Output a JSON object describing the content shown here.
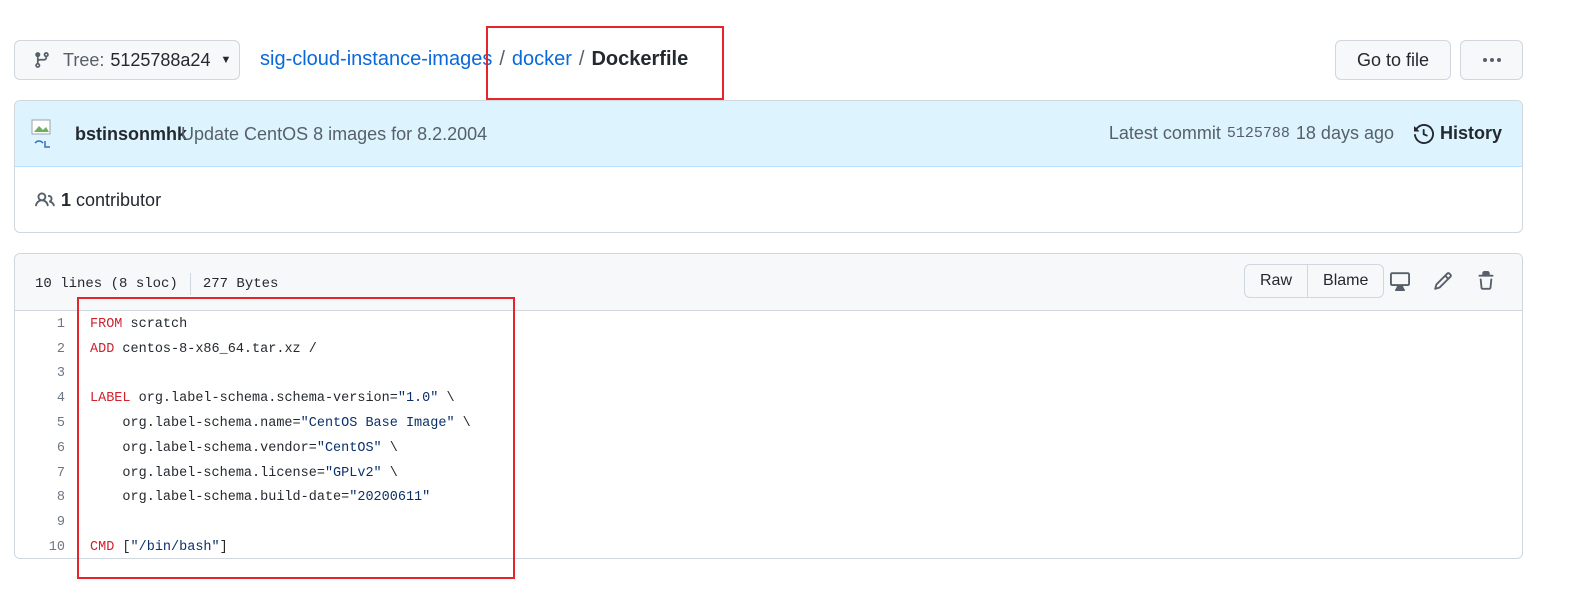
{
  "branch": {
    "label": "Tree:",
    "sha": "5125788a24"
  },
  "breadcrumb": {
    "repo": "sig-cloud-instance-images",
    "folder": "docker",
    "file": "Dockerfile",
    "separator": "/"
  },
  "actions": {
    "go_to_file": "Go to file",
    "more": "more-icon"
  },
  "commit": {
    "author": "bstinsonmhk",
    "message": "Update CentOS 8 images for 8.2.2004",
    "latest_label": "Latest commit",
    "sha": "5125788",
    "time": "18 days ago",
    "history_label": "History"
  },
  "contributors": {
    "count": "1",
    "label": "contributor"
  },
  "file": {
    "lines_info": "10 lines (8 sloc)",
    "size": "277 Bytes",
    "raw_label": "Raw",
    "blame_label": "Blame"
  },
  "code": {
    "line_numbers": [
      "1",
      "2",
      "3",
      "4",
      "5",
      "6",
      "7",
      "8",
      "9",
      "10"
    ],
    "lines": [
      {
        "kw": "FROM",
        "rest": " scratch",
        "str": "",
        "tail": ""
      },
      {
        "kw": "ADD",
        "rest": " centos-8-x86_64.tar.xz /",
        "str": "",
        "tail": ""
      },
      {
        "kw": "",
        "rest": "",
        "str": "",
        "tail": ""
      },
      {
        "kw": "LABEL",
        "rest": " org.label-schema.schema-version=",
        "str": "\"1.0\"",
        "tail": " \\"
      },
      {
        "kw": "",
        "rest": "    org.label-schema.name=",
        "str": "\"CentOS Base Image\"",
        "tail": " \\"
      },
      {
        "kw": "",
        "rest": "    org.label-schema.vendor=",
        "str": "\"CentOS\"",
        "tail": " \\"
      },
      {
        "kw": "",
        "rest": "    org.label-schema.license=",
        "str": "\"GPLv2\"",
        "tail": " \\"
      },
      {
        "kw": "",
        "rest": "    org.label-schema.build-date=",
        "str": "\"20200611\"",
        "tail": ""
      },
      {
        "kw": "",
        "rest": "",
        "str": "",
        "tail": ""
      },
      {
        "kw": "CMD",
        "rest": " [",
        "str": "\"/bin/bash\"",
        "tail": "]"
      }
    ]
  },
  "colors": {
    "link": "#0969da",
    "keyword": "#cf222e",
    "string": "#0a3069",
    "annotation": "#e5252a"
  }
}
